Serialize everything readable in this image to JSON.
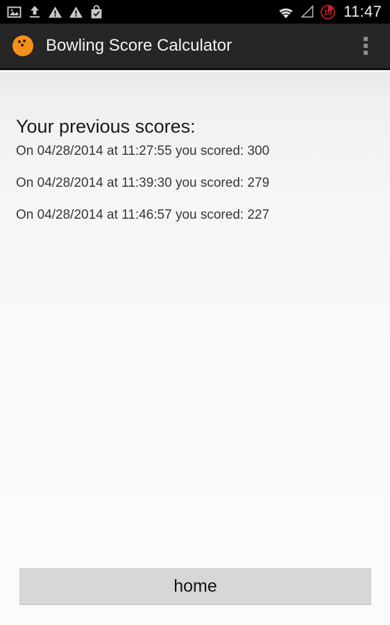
{
  "status_bar": {
    "icons": [
      {
        "name": "image-icon",
        "label": "image"
      },
      {
        "name": "upload-icon",
        "label": "upload"
      },
      {
        "name": "warning-icon",
        "label": "warning"
      },
      {
        "name": "warning-icon-2",
        "label": "warning"
      },
      {
        "name": "bag-check-icon",
        "label": "app installed"
      }
    ],
    "wifi_icon": "wifi-icon",
    "signal_icon": "signal-icon",
    "battery_badge": "10",
    "battery_icon": "battery-circle-icon",
    "time": "11:47"
  },
  "action_bar": {
    "app_icon": "bowling-ball-icon",
    "title": "Bowling Score Calculator",
    "overflow_icon": "overflow-menu-icon"
  },
  "main": {
    "heading": "Your previous scores:",
    "scores": [
      {
        "text": "On 04/28/2014 at 11:27:55 you scored: 300",
        "date": "04/28/2014",
        "time": "11:27:55",
        "score": 300
      },
      {
        "text": "On 04/28/2014 at 11:39:30 you scored: 279",
        "date": "04/28/2014",
        "time": "11:39:30",
        "score": 279
      },
      {
        "text": "On 04/28/2014 at 11:46:57 you scored: 227",
        "date": "04/28/2014",
        "time": "11:46:57",
        "score": 227
      }
    ]
  },
  "footer": {
    "home_button_label": "home"
  },
  "colors": {
    "status_bar_bg": "#000000",
    "action_bar_bg": "#262626",
    "accent_orange": "#f59118",
    "battery_red": "#cc2027",
    "button_bg": "#d7d7d7",
    "content_bg": "#fafafa"
  }
}
